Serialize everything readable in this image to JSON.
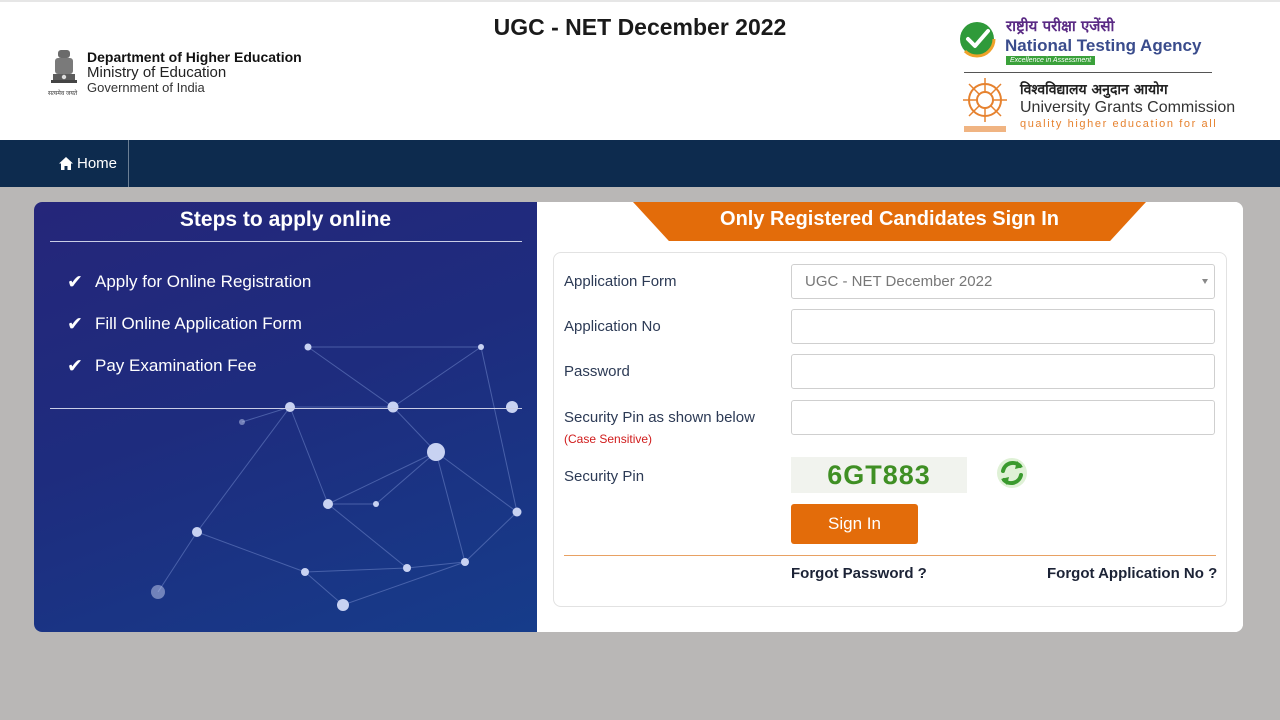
{
  "header": {
    "title": "UGC - NET December 2022",
    "dept": {
      "line1": "Department of Higher Education",
      "line2": "Ministry of Education",
      "line3": "Government of India",
      "emblem_caption": "सत्यमेव जयते"
    },
    "nta": {
      "hindi": "राष्ट्रीय परीक्षा एजेंसी",
      "english": "National Testing Agency",
      "tagline": "Excellence in Assessment"
    },
    "ugc": {
      "hindi": "विश्वविद्यालय अनुदान आयोग",
      "english": "University Grants Commission",
      "tagline": "quality higher education for all"
    }
  },
  "nav": {
    "home_label": "Home"
  },
  "steps": {
    "title": "Steps to apply online",
    "items": [
      "Apply for Online Registration",
      "Fill Online Application Form",
      "Pay Examination Fee"
    ]
  },
  "signin": {
    "banner": "Only Registered Candidates Sign In",
    "fields": {
      "application_form_label": "Application Form",
      "application_form_value": "UGC - NET December 2022",
      "application_no_label": "Application No",
      "application_no_value": "",
      "password_label": "Password",
      "password_value": "",
      "security_pin_input_label": "Security Pin as shown below",
      "case_sensitive": "(Case Sensitive)",
      "security_pin_input_value": "",
      "security_pin_label": "Security Pin",
      "captcha_text": "6GT883"
    },
    "button_label": "Sign In",
    "forgot_password": "Forgot Password ?",
    "forgot_application_no": "Forgot Application No ?"
  },
  "colors": {
    "accent_orange": "#e36c0a",
    "navbar": "#0d2b4e",
    "panel_blue": "#1e2c7e"
  }
}
